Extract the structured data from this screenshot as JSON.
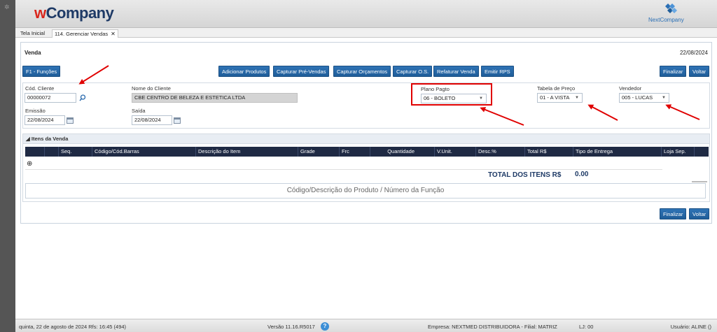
{
  "header": {
    "logo_w": "w",
    "logo_company": "Company",
    "brand_next": "NextCompany"
  },
  "tabs": [
    {
      "label": "Tela Inicial"
    },
    {
      "label": "114. Gerenciar Vendas",
      "close": "✕"
    }
  ],
  "panel": {
    "title": "Venda",
    "date": "22/08/2024"
  },
  "toolbar": {
    "f1": "F1 - Funções",
    "adicionar": "Adicionar Produtos",
    "pre_vendas": "Capturar Pré-Vendas",
    "orcamentos": "Capturar Orçamentos",
    "os": "Capturar O.S.",
    "refaturar": "Refaturar Venda",
    "rps": "Emitir RPS",
    "finalizar": "Finalizar",
    "voltar": "Voltar"
  },
  "form": {
    "cod_cliente_label": "Cód. Cliente",
    "cod_cliente_value": "00000072",
    "nome_cliente_label": "Nome do Cliente",
    "nome_cliente_value": "CBE CENTRO DE BELEZA E ESTETICA LTDA",
    "plano_label": "Plano Pagto",
    "plano_value": "06 - BOLETO",
    "tabela_label": "Tabela de Preço",
    "tabela_value": "01 - A VISTA",
    "vendedor_label": "Vendedor",
    "vendedor_value": "005 - LUCAS",
    "emissao_label": "Emissão",
    "emissao_value": "22/08/2024",
    "saida_label": "Saída",
    "saida_value": "22/08/2024"
  },
  "itens": {
    "title": "Itens da Venda",
    "columns": [
      "Seq.",
      "Código/Cód.Barras",
      "Descrição do Item",
      "Grade",
      "Frc",
      "Quantidade",
      "V.Unit.",
      "Desc.%",
      "Total R$",
      "Tipo de Entrega",
      "Loja Sep."
    ],
    "add_icon": "⊕",
    "total_label": "TOTAL DOS ITENS R$",
    "total_value": "0.00",
    "search_placeholder": "Código/Descrição do Produto / Número da Função"
  },
  "bottom": {
    "finalizar": "Finalizar",
    "voltar": "Voltar"
  },
  "status": {
    "datetime": "quinta, 22 de agosto de 2024  Rfs: 16:45 (494)",
    "versao": "Versão 11.16.R5017",
    "help": "?",
    "empresa": "Empresa: NEXTMED DISTRIBUIDORA - Filial: MATRIZ",
    "lj": "LJ: 00",
    "usuario": "Usuário: ALINE ()"
  },
  "colors": {
    "button": "#2a6aad",
    "grid_header": "#1f2a44",
    "annotation": "#e00000",
    "total_text": "#1e3a66"
  }
}
